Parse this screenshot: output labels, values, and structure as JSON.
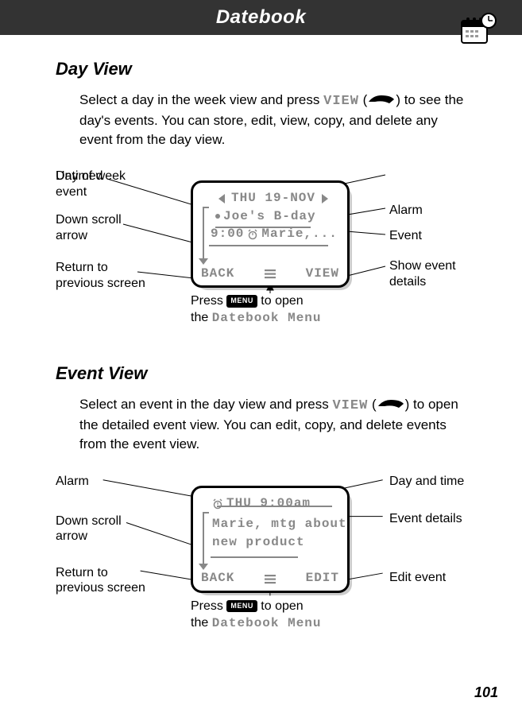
{
  "header": {
    "title": "Datebook"
  },
  "page_number": "101",
  "section1": {
    "heading": "Day View",
    "para_pre": "Select a day in the week view and press ",
    "view_word": "VIEW",
    "para_mid": " (",
    "para_post": ") to see the day's events. You can store, edit, view, copy, and delete any event from the day view."
  },
  "screen1": {
    "date": "THU 19-NOV",
    "untimed": "Joe's B-day",
    "time": "9:00",
    "event_text": "Marie,...",
    "back": "BACK",
    "right_soft": "VIEW"
  },
  "callouts1": {
    "l1": "Untimed\nevent",
    "l2": "Down scroll\narrow",
    "l3": "Return to\nprevious screen",
    "r1": "Day of week",
    "r2": "Alarm",
    "r3": "Event",
    "r4": "Show event\ndetails",
    "caption_pre": "Press ",
    "caption_post": " to open\nthe ",
    "caption_menu": "Datebook Menu",
    "menu_key": "MENU"
  },
  "section2": {
    "heading": "Event View",
    "para_pre": "Select an event in the day view and press ",
    "view_word": "VIEW",
    "para_mid": " (",
    "para_post": ") to open the detailed event view. You can edit, copy, and delete events from the event view."
  },
  "screen2": {
    "daytime": "THU 9:00am",
    "line1": "Marie, mtg about",
    "line2": "new product",
    "back": "BACK",
    "right_soft": "EDIT"
  },
  "callouts2": {
    "l1": "Alarm",
    "l2": "Down scroll\narrow",
    "l3": "Return to\nprevious screen",
    "r1": "Day and time",
    "r2": "Event details",
    "r3": "Edit event",
    "caption_pre": "Press ",
    "caption_post": " to open\nthe ",
    "caption_menu": "Datebook Menu",
    "menu_key": "MENU"
  }
}
